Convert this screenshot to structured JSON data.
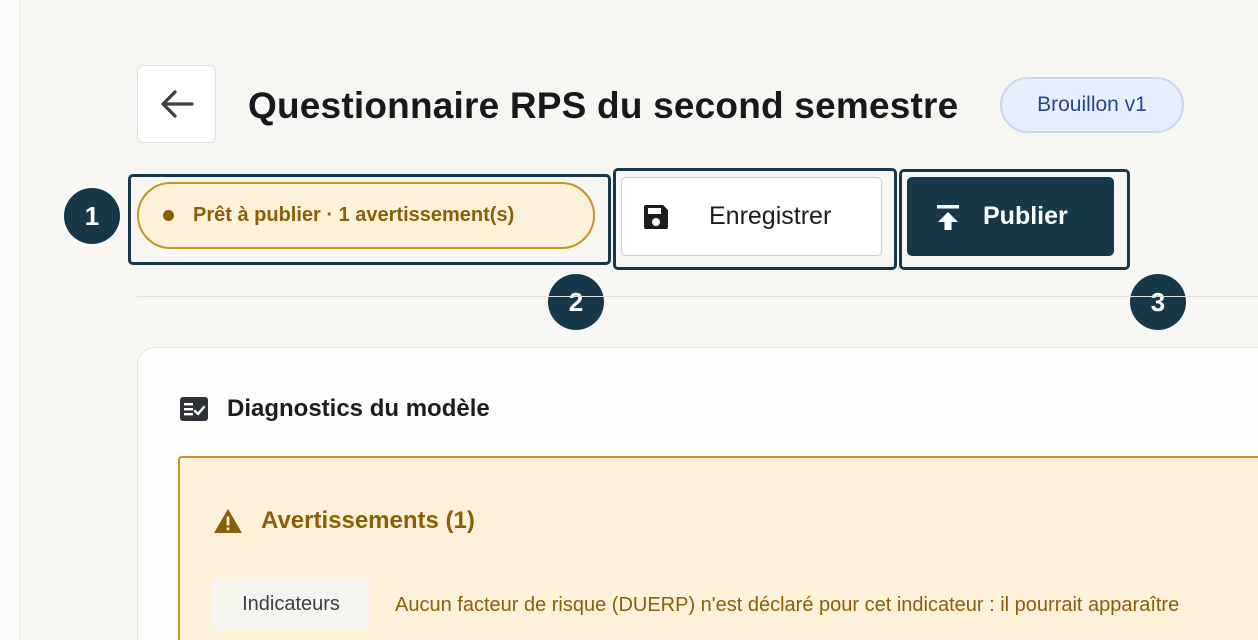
{
  "header": {
    "title": "Questionnaire RPS du second semestre",
    "version_badge": "Brouillon v1",
    "back_icon": "arrow-left-icon"
  },
  "toolbar": {
    "status_label": "Prêt à publier · 1 avertissement(s)",
    "save_label": "Enregistrer",
    "save_icon": "floppy-disk-icon",
    "publish_label": "Publier",
    "publish_icon": "upload-icon"
  },
  "callouts": [
    "1",
    "2",
    "3"
  ],
  "diagnostics": {
    "title": "Diagnostics du modèle",
    "icon": "checklist-icon",
    "warnings": {
      "title": "Avertissements (1)",
      "icon": "warning-triangle-icon",
      "items": [
        {
          "category": "Indicateurs",
          "message": "Aucun facteur de risque (DUERP) n'est déclaré pour cet indicateur : il pourrait apparaître"
        }
      ]
    }
  },
  "colors": {
    "primary": "#163848",
    "warning_text": "#8b5f08",
    "warning_border": "#c79322",
    "warning_bg": "#fdf1da",
    "badge_bg": "#e8effc",
    "badge_text": "#27468f"
  }
}
